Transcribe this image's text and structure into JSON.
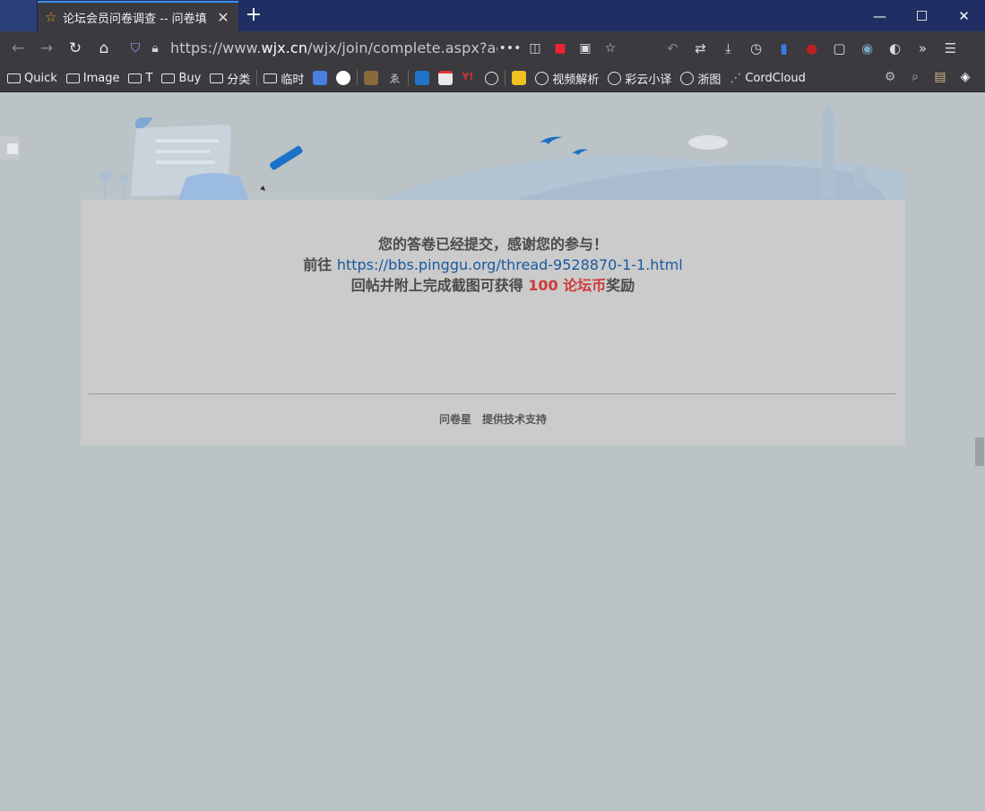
{
  "browser": {
    "tab_title": "论坛会员问卷调查 -- 问卷填",
    "tab_close": "✕",
    "new_tab": "+",
    "window": {
      "minimize": "—",
      "maximize": "☐",
      "close": "✕"
    },
    "url_prefix": "https://www.",
    "url_domain": "wjx.cn",
    "url_rest": "/wjx/join/complete.aspx?activi"
  },
  "bookmarks": [
    {
      "label": "Quick",
      "kind": "folder"
    },
    {
      "label": "Image",
      "kind": "folder"
    },
    {
      "label": "T",
      "kind": "folder"
    },
    {
      "label": "Buy",
      "kind": "folder"
    },
    {
      "label": "分类",
      "kind": "folder"
    },
    {
      "label": "临时",
      "kind": "folder"
    },
    {
      "label": "视频解析",
      "kind": "globe"
    },
    {
      "label": "彩云小译",
      "kind": "globe"
    },
    {
      "label": "浙图",
      "kind": "globe"
    },
    {
      "label": "CordCloud",
      "kind": "link"
    }
  ],
  "content": {
    "line1": "您的答卷已经提交，感谢您的参与！",
    "line2_prefix": "前往 ",
    "line2_link": "https://bbs.pinggu.org/thread-9528870-1-1.html",
    "line3_prefix": "回帖并附上完成截图可获得 ",
    "line3_reward": "100 论坛币",
    "line3_suffix": "奖励",
    "footer_brand": "问卷星",
    "footer_text": "提供技术支持"
  },
  "colors": {
    "page_bg": "#bcc3c7",
    "card_bg": "#cbcbcb",
    "link": "#1a5aa0",
    "reward": "#d03a3a",
    "tab_accent": "#3d8fe6"
  }
}
